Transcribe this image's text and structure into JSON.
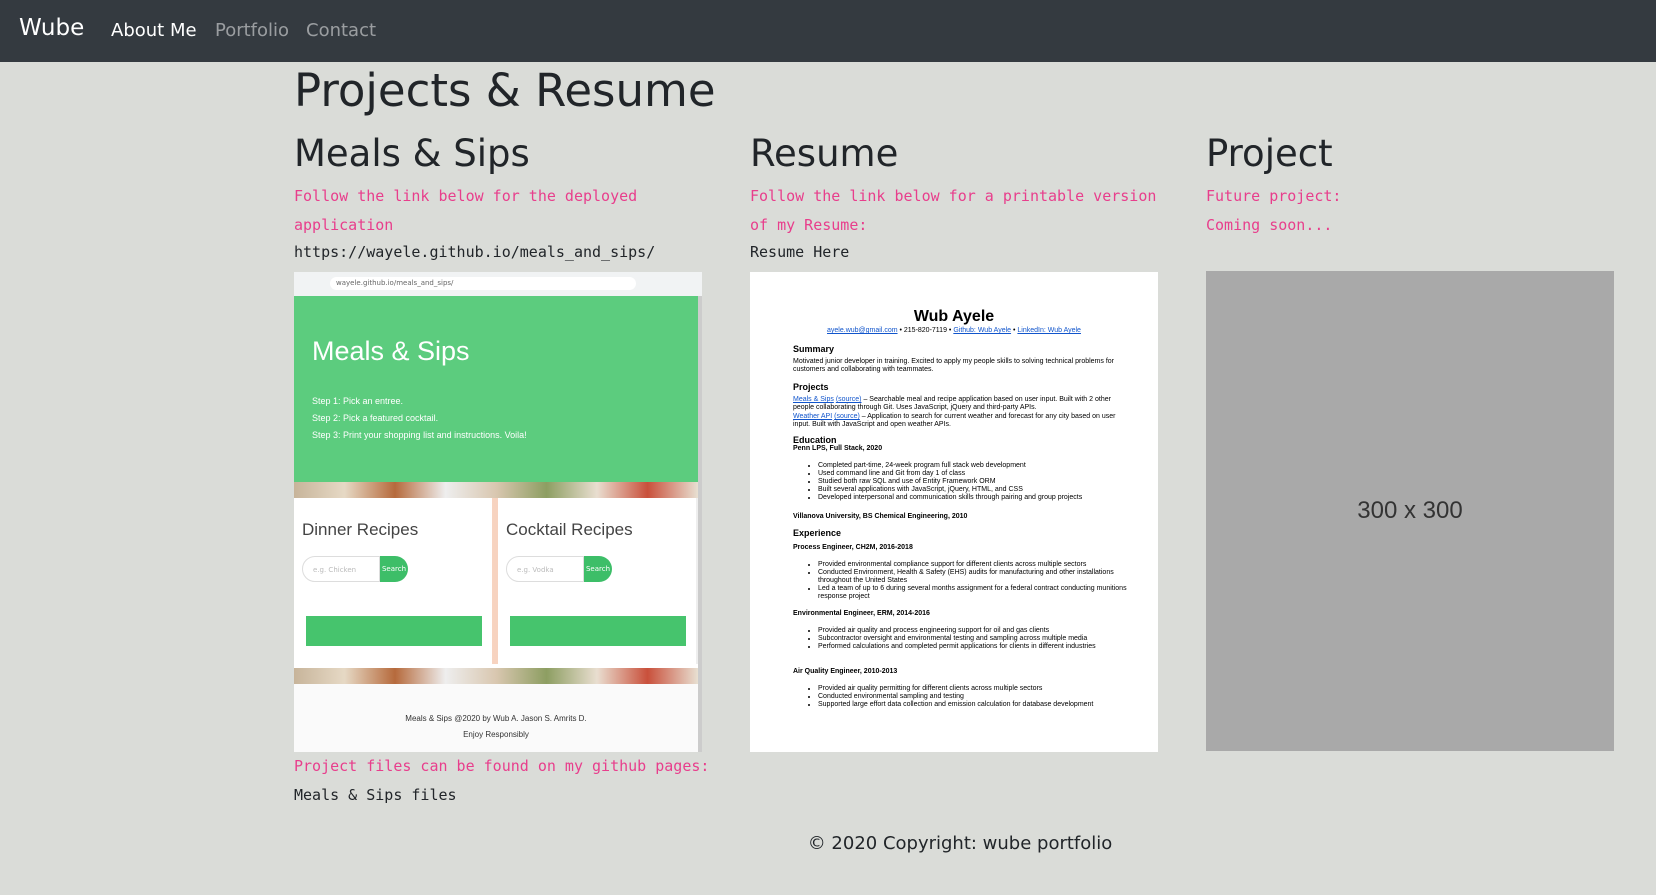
{
  "nav": {
    "brand": "Wube",
    "links": [
      "About Me",
      "Portfolio",
      "Contact"
    ]
  },
  "page_title": "Projects & Resume",
  "meals": {
    "heading": "Meals & Sips",
    "description": "Follow the link below for the deployed application",
    "url": "https://wayele.github.io/meals_and_sips/",
    "screenshot": {
      "address_bar": "wayele.github.io/meals_and_sips/",
      "hero_title": "Meals & Sips",
      "steps": [
        "Step 1: Pick an entree.",
        "Step 2: Pick a featured cocktail.",
        "Step 3: Print your shopping list and instructions. Voila!"
      ],
      "cards": [
        {
          "title": "Dinner Recipes",
          "placeholder": "e.g. Chicken",
          "button": "Search"
        },
        {
          "title": "Cocktail Recipes",
          "placeholder": "e.g. Vodka",
          "button": "Search"
        }
      ],
      "footer_line1": "Meals & Sips @2020 by Wub A. Jason S. Amrits D.",
      "footer_line2": "Enjoy Responsibly"
    },
    "files_prefix": "Project files can be found on my github pages:",
    "files_link": "Meals & Sips files"
  },
  "resume": {
    "heading": "Resume",
    "description": "Follow the link below for a printable version of my Resume:",
    "link": "Resume Here",
    "doc": {
      "name": "Wub Ayele",
      "email": "ayele.wub@gmail.com",
      "phone": "215-820-7119",
      "github": "Github: Wub Ayele",
      "linkedin": "LinkedIn: Wub Ayele",
      "summary_h": "Summary",
      "summary": "Motivated junior developer in training. Excited to apply my people skills to solving technical problems for customers and collaborating with teammates.",
      "projects_h": "Projects",
      "project1_link": "Meals & Sips",
      "project1_src": "(source)",
      "project1": "– Searchable meal and recipe application based on user input. Built with 2 other people collaborating through Git. Uses JavaScript, jQuery and third-party APIs.",
      "project2_link": "Weather API",
      "project2_src": "(source)",
      "project2": "– Application to search for current weather and forecast for any city based on user input. Built with JavaScript and open weather APIs.",
      "education_h": "Education",
      "edu1": "Penn LPS, Full Stack, 2020",
      "edu1_items": [
        "Completed part-time, 24-week program full stack web development",
        "Used command line and Git from day 1 of class",
        "Studied both raw SQL and use of Entity Framework ORM",
        "Built several applications with JavaScript, jQuery, HTML, and CSS",
        "Developed interpersonal and communication skills through pairing and group projects"
      ],
      "edu2": "Villanova University, BS Chemical Engineering, 2010",
      "experience_h": "Experience",
      "job1": "Process Engineer, CH2M, 2016-2018",
      "job1_items": [
        "Provided environmental compliance support for different clients across multiple sectors",
        "Conducted Environment, Health & Safety (EHS) audits for manufacturing and other installations throughout the United States",
        "Led a team of up to 6 during several months assignment for a federal contract conducting munitions response project"
      ],
      "job2": "Environmental Engineer, ERM, 2014-2016",
      "job2_items": [
        "Provided air quality and process engineering support for oil and gas clients",
        "Subcontractor oversight and environmental testing and sampling across multiple media",
        "Performed calculations and completed permit applications for clients in different industries"
      ],
      "job3": "Air Quality Engineer, 2010-2013",
      "job3_items": [
        "Provided air quality permitting for different clients across multiple sectors",
        "Conducted environmental sampling and testing",
        "Supported large effort data collection and emission calculation for database development"
      ]
    }
  },
  "project": {
    "heading": "Project",
    "line1": "Future project:",
    "line2": "Coming soon...",
    "placeholder": "300 x 300"
  },
  "footer": {
    "copyright": "© 2020 Copyright: wube portfolio"
  },
  "colors": {
    "navbar": "#343a40",
    "background": "#dadcd8",
    "code_pink": "#e83e8c",
    "meals_green": "#5ccc7e"
  }
}
